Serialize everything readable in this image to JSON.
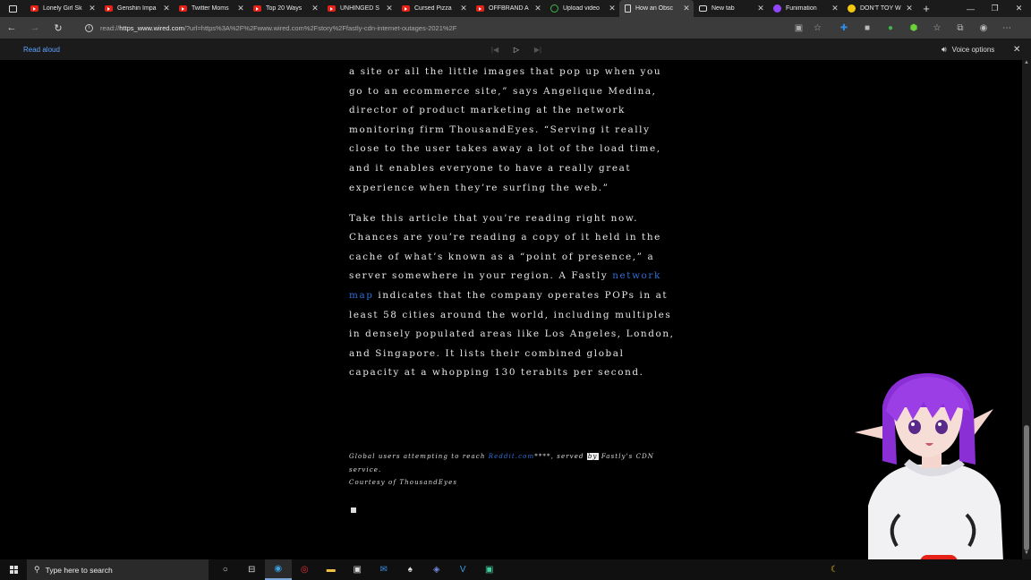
{
  "tabs": [
    {
      "title": "Lonely Girl Sk",
      "favicon": "youtube-icon",
      "active": false
    },
    {
      "title": "Genshin Impa",
      "favicon": "youtube-icon",
      "active": false
    },
    {
      "title": "Twitter Moms",
      "favicon": "youtube-icon",
      "active": false
    },
    {
      "title": "Top 20 Ways",
      "favicon": "youtube-icon",
      "active": false
    },
    {
      "title": "UNHINGED S",
      "favicon": "youtube-icon",
      "active": false
    },
    {
      "title": "Cursed Pizza",
      "favicon": "youtube-icon",
      "active": false
    },
    {
      "title": "OFFBRAND A",
      "favicon": "youtube-icon",
      "active": false
    },
    {
      "title": "Upload video",
      "favicon": "upload-icon",
      "active": false
    },
    {
      "title": "How an Obsc",
      "favicon": "page-icon",
      "active": true
    },
    {
      "title": "New tab",
      "favicon": "new-tab-icon",
      "active": false
    },
    {
      "title": "Funimation",
      "favicon": "funimation-icon",
      "active": false
    },
    {
      "title": "DON'T TOY W",
      "favicon": "page-icon",
      "active": false
    }
  ],
  "address_bar": {
    "prefix": "read://",
    "host": "https_www.wired.com",
    "rest": "/?url=https%3A%2F%2Fwww.wired.com%2Fstory%2Ffastly-cdn-internet-outages-2021%2F"
  },
  "read_aloud": {
    "label": "Read aloud",
    "voice_options": "Voice options"
  },
  "article": {
    "p1": "a site or all the little images that pop up when you go to an ecommerce site,” says Angelique Medina, director of product marketing at the network monitoring firm ThousandEyes. “Serving it really close to the user takes away a lot of the load time, and it enables everyone to have a really great experience when they’re surfing the web.”",
    "p2_before": "Take this article that you’re reading right now. Chances are you’re reading a copy of it held in the cache of what’s known as a “point of presence,” a server somewhere in your region. A Fastly",
    "p2_link": "network map",
    "p2_after": "indicates that the company operates POPs in at least 58 cities around the world, including multiples in densely populated areas like Los Angeles, London, and Singapore. It lists their combined global capacity at a whopping 130 terabits per second.",
    "caption_before": "Global users attempting to reach",
    "caption_link": "Reddit.com",
    "caption_mid": "****, served",
    "caption_hl": "by",
    "caption_after": "Fastly's CDN service.",
    "credit": "Courtesy of ThousandEyes"
  },
  "taskbar": {
    "search_placeholder": "Type here to search"
  },
  "colors": {
    "link": "#2f6fd6",
    "read_aloud_label": "#5ea2ff",
    "active_tab": "#3b3b3b"
  }
}
